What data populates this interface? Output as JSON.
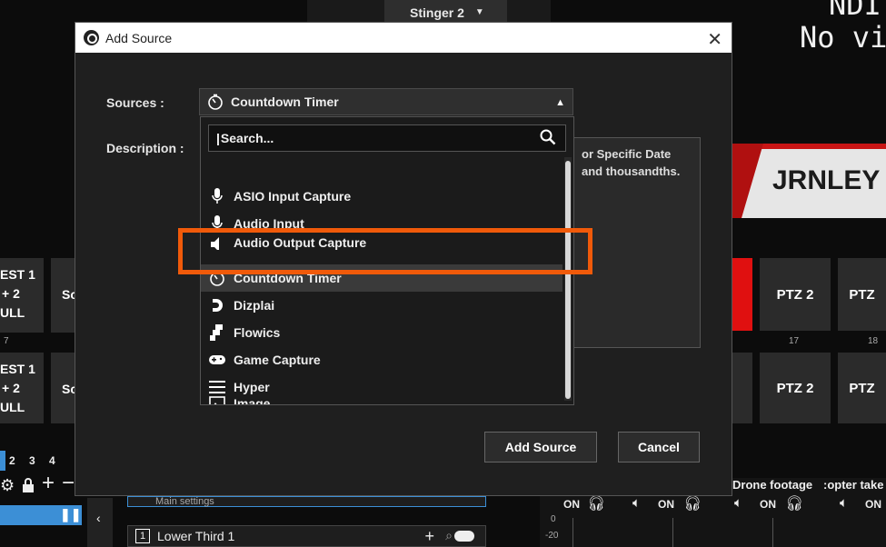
{
  "background": {
    "stinger_label": "Stinger 2",
    "preview_line1": "NDI",
    "preview_line2": "No vi",
    "banner_text": "JRNLEY",
    "left_buttons": [
      {
        "line1": "EST 1",
        "line2": "+ 2",
        "line3": "ULL"
      },
      {
        "line1": "EST 1",
        "line2": "+ 2",
        "line3": "ULL"
      }
    ],
    "left_sc_labels": [
      "Sc",
      "Sc"
    ],
    "left_numbers": [
      "7"
    ],
    "ptz_buttons": [
      "PTZ 2",
      "PTZ",
      "PTZ 2",
      "PTZ"
    ],
    "ptz_numbers": [
      "17",
      "18"
    ],
    "tab_numbers": [
      "2",
      "3",
      "4"
    ],
    "lower_third_number": "1",
    "lower_third_label": "Lower Third 1",
    "main_settings": "Main settings",
    "drone_label": "Drone footage",
    "copter_label": ":opter take",
    "audio_on": "ON",
    "meter_labels": [
      "0",
      "-20"
    ]
  },
  "dialog": {
    "title": "Add Source",
    "close_glyph": "✕",
    "sources_label": "Sources :",
    "description_label": "Description :",
    "selected_source": "Countdown Timer",
    "description_text": "or Specific Date and thousandths.",
    "search_placeholder": "Search...",
    "items": [
      {
        "label": "ASIO Input Capture",
        "icon": "microphone-icon"
      },
      {
        "label": "Audio Input",
        "icon": "microphone-icon"
      },
      {
        "label": "Audio Output Capture",
        "icon": "speaker-icon"
      },
      {
        "label": "Countdown Timer",
        "icon": "timer-icon"
      },
      {
        "label": "Dizplai",
        "icon": "dizplai-icon"
      },
      {
        "label": "Flowics",
        "icon": "flowics-icon"
      },
      {
        "label": "Game Capture",
        "icon": "gamepad-icon"
      },
      {
        "label": "Hyper",
        "icon": "hamburger-icon"
      },
      {
        "label": "Image",
        "icon": "image-icon"
      }
    ],
    "add_button": "Add Source",
    "cancel_button": "Cancel"
  },
  "colors": {
    "highlight": "#f05a0a",
    "accent_blue": "#3c8fd6",
    "tally_red": "#e01010"
  }
}
